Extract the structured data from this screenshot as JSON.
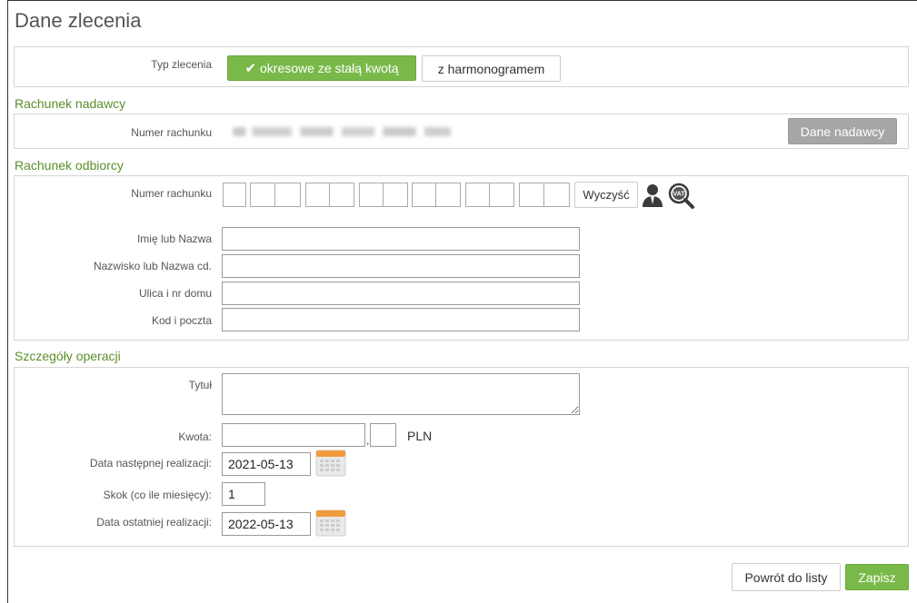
{
  "page_title": "Dane zlecenia",
  "order_type": {
    "label": "Typ zlecenia",
    "option_fixed": "okresowe ze stałą kwotą",
    "option_schedule": "z harmonogramem",
    "selected": "okresowe ze stałą kwotą"
  },
  "sender": {
    "section_title": "Rachunek nadawcy",
    "account_label": "Numer rachunku",
    "sender_data_button": "Dane nadawcy"
  },
  "recipient": {
    "section_title": "Rachunek odbiorcy",
    "account_label": "Numer rachunku",
    "clear_button": "Wyczyść",
    "name_label": "Imię lub Nazwa",
    "surname_label": "Nazwisko lub Nazwa cd.",
    "street_label": "Ulica i nr domu",
    "postal_label": "Kod i poczta",
    "name_value": "",
    "surname_value": "",
    "street_value": "",
    "postal_value": "",
    "contact_icon": "person-icon",
    "vat_icon": "vat-search-icon",
    "vat_icon_text": "VAT"
  },
  "details": {
    "section_title": "Szczegóły operacji",
    "title_label": "Tytuł",
    "title_value": "",
    "amount_label": "Kwota:",
    "amount_value": "",
    "amount_cents_value": "",
    "currency": "PLN",
    "next_date_label": "Data następnej realizacji:",
    "next_date_value": "2021-05-13",
    "step_label": "Skok (co ile miesięcy):",
    "step_value": "1",
    "last_date_label": "Data ostatniej realizacji:",
    "last_date_value": "2022-05-13"
  },
  "footer": {
    "back_button": "Powrót do listy",
    "save_button": "Zapisz"
  },
  "colors": {
    "accent_green": "#79b94a",
    "section_title_green": "#5a8f2a",
    "grey_button": "#a6a6a6"
  }
}
